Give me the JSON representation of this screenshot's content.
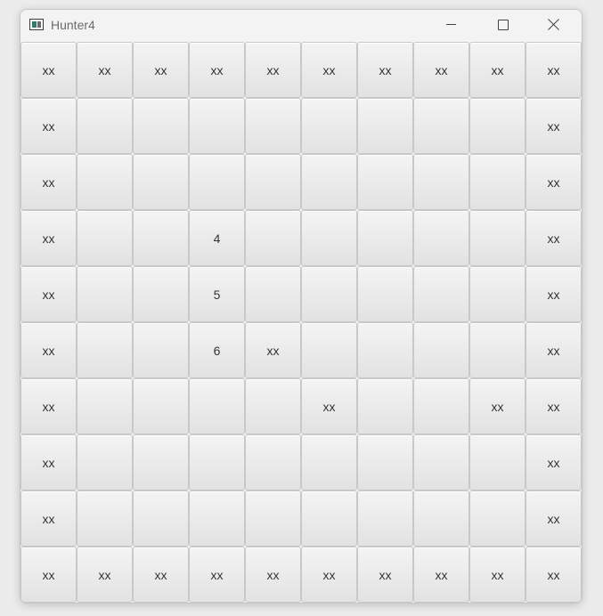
{
  "window": {
    "title": "Hunter4",
    "icon": "app-window-icon",
    "controls": [
      "minimize-icon",
      "maximize-icon",
      "close-icon"
    ]
  },
  "board": {
    "rows": 10,
    "cols": 10,
    "cells": [
      [
        "xx",
        "xx",
        "xx",
        "xx",
        "xx",
        "xx",
        "xx",
        "xx",
        "xx",
        "xx"
      ],
      [
        "xx",
        "",
        "",
        "",
        "",
        "",
        "",
        "",
        "",
        "xx"
      ],
      [
        "xx",
        "",
        "",
        "",
        "",
        "",
        "",
        "",
        "",
        "xx"
      ],
      [
        "xx",
        "",
        "",
        "4",
        "",
        "",
        "",
        "",
        "",
        "xx"
      ],
      [
        "xx",
        "",
        "",
        "5",
        "",
        "",
        "",
        "",
        "",
        "xx"
      ],
      [
        "xx",
        "",
        "",
        "6",
        "xx",
        "",
        "",
        "",
        "",
        "xx"
      ],
      [
        "xx",
        "",
        "",
        "",
        "",
        "xx",
        "",
        "",
        "xx",
        "xx"
      ],
      [
        "xx",
        "",
        "",
        "",
        "",
        "",
        "",
        "",
        "",
        "xx"
      ],
      [
        "xx",
        "",
        "",
        "",
        "",
        "",
        "",
        "",
        "",
        "xx"
      ],
      [
        "xx",
        "xx",
        "xx",
        "xx",
        "xx",
        "xx",
        "xx",
        "xx",
        "xx",
        "xx"
      ]
    ]
  }
}
